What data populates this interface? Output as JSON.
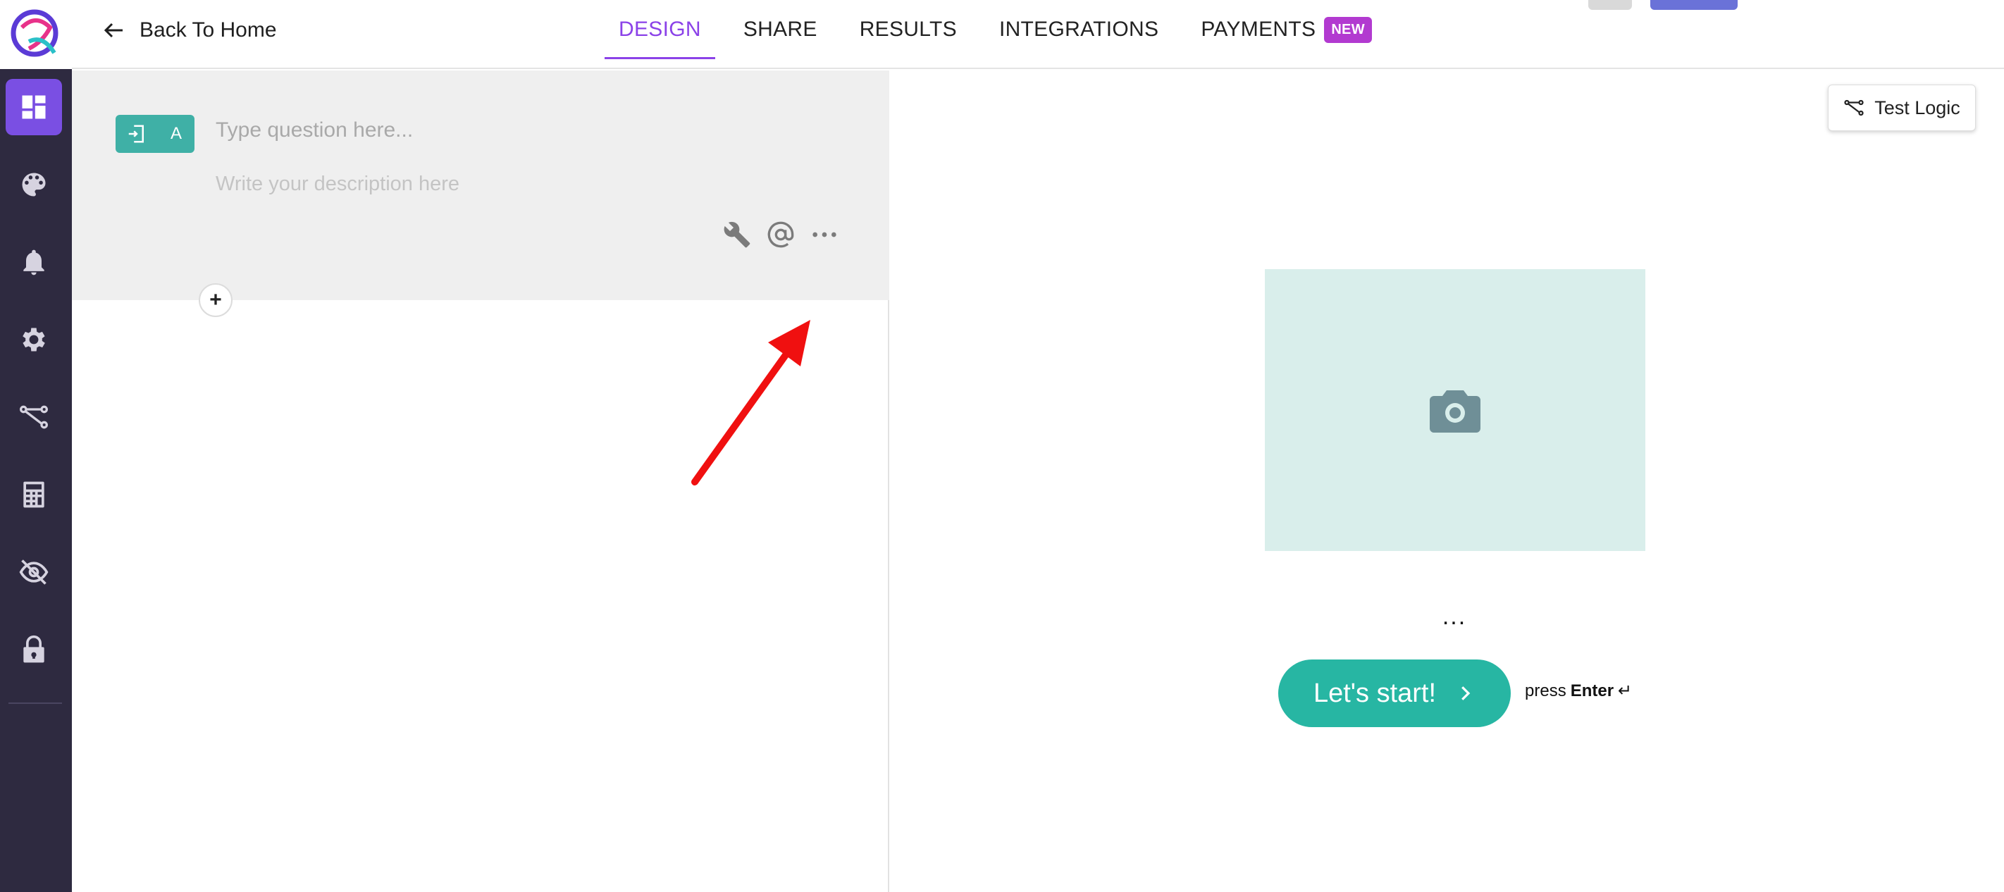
{
  "header": {
    "back_label": "Back To Home",
    "tabs": [
      {
        "label": "DESIGN",
        "active": true
      },
      {
        "label": "SHARE",
        "active": false
      },
      {
        "label": "RESULTS",
        "active": false
      },
      {
        "label": "INTEGRATIONS",
        "active": false
      },
      {
        "label": "PAYMENTS",
        "active": false,
        "badge": "NEW"
      }
    ]
  },
  "sidebar": {
    "items": [
      {
        "icon": "dashboard-icon",
        "active": true
      },
      {
        "icon": "palette-icon",
        "active": false
      },
      {
        "icon": "bell-icon",
        "active": false
      },
      {
        "icon": "gear-icon",
        "active": false
      },
      {
        "icon": "logic-flow-icon",
        "active": false
      },
      {
        "icon": "calculator-icon",
        "active": false
      },
      {
        "icon": "eye-off-icon",
        "active": false
      },
      {
        "icon": "lock-icon",
        "active": false
      }
    ]
  },
  "editor": {
    "question_badge_letter": "A",
    "question_placeholder": "Type question here...",
    "description_placeholder": "Write your description here",
    "tools": [
      "wrench-icon",
      "at-icon",
      "more-icon"
    ],
    "add_label": "+"
  },
  "preview": {
    "test_logic_label": "Test Logic",
    "ellipsis": "...",
    "start_label": "Let's start!",
    "press_prefix": "press",
    "press_key": "Enter",
    "press_symbol": "↵"
  },
  "colors": {
    "accent": "#8b42e8",
    "sidebar_bg": "#2e2a40",
    "teal": "#27b6a3",
    "badge": "#b23ad0",
    "annotation_arrow": "#f01010"
  }
}
